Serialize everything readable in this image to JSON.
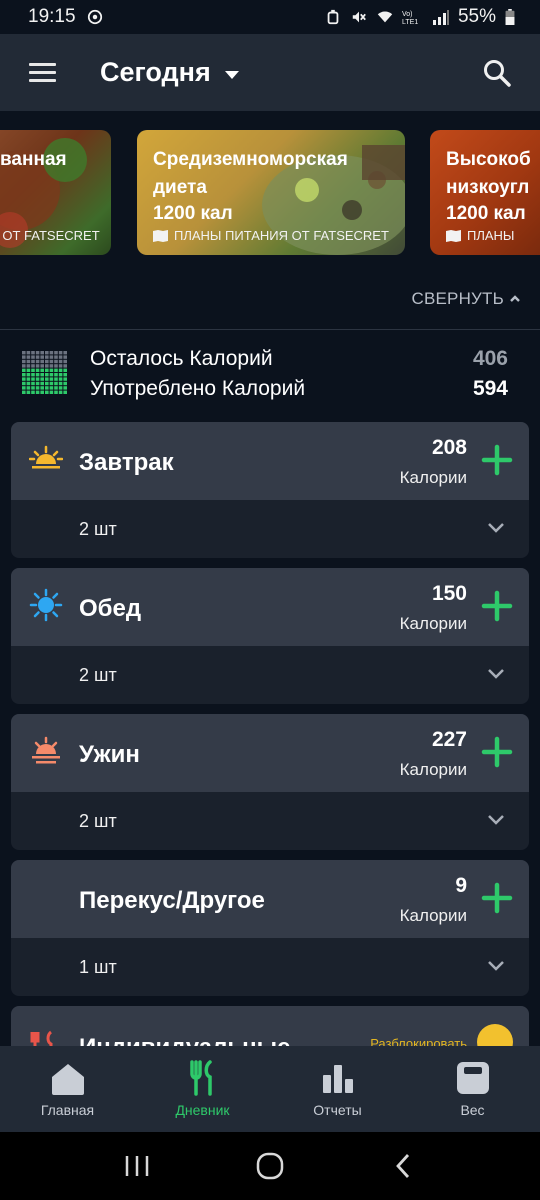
{
  "status": {
    "time": "19:15",
    "battery": "55%"
  },
  "appbar": {
    "title": "Сегодня"
  },
  "carousel": {
    "cards": [
      {
        "title": "ванная",
        "calories": "",
        "source": "ЯЯ ОТ FATSECRET"
      },
      {
        "title_line1": "Средиземноморская",
        "title_line2": "диета",
        "calories": "1200 кал",
        "source": "ПЛАНЫ ПИТАНИЯ ОТ FATSECRET"
      },
      {
        "title_line1": "Высокоб",
        "title_line2": "низкоугл",
        "calories": "1200 кал",
        "source": "ПЛАНЫ"
      }
    ]
  },
  "collapse_label": "СВЕРНУТЬ",
  "summary": {
    "remaining_label": "Осталось Калорий",
    "remaining_value": "406",
    "consumed_label": "Употреблено Калорий",
    "consumed_value": "594"
  },
  "meals": [
    {
      "name": "Завтрак",
      "calories": "208",
      "calories_label": "Калории",
      "count": "2 шт",
      "icon": "sunrise-icon"
    },
    {
      "name": "Обед",
      "calories": "150",
      "calories_label": "Калории",
      "count": "2 шт",
      "icon": "sun-icon"
    },
    {
      "name": "Ужин",
      "calories": "227",
      "calories_label": "Калории",
      "count": "2 шт",
      "icon": "sunset-icon"
    },
    {
      "name": "Перекус/Другое",
      "calories": "9",
      "calories_label": "Калории",
      "count": "1 шт",
      "icon": "moon-icon"
    }
  ],
  "partial_meal": {
    "name": "Индивидуальные",
    "link": "Разблокировать"
  },
  "bottom_nav": [
    {
      "label": "Главная",
      "icon": "home-icon"
    },
    {
      "label": "Дневник",
      "icon": "fork-knife-icon"
    },
    {
      "label": "Отчеты",
      "icon": "bar-chart-icon"
    },
    {
      "label": "Вес",
      "icon": "scale-icon"
    }
  ],
  "colors": {
    "accent_green": "#2ec96a",
    "background": "#0b121d",
    "card_header": "#343b48",
    "app_bar": "#222a36"
  }
}
